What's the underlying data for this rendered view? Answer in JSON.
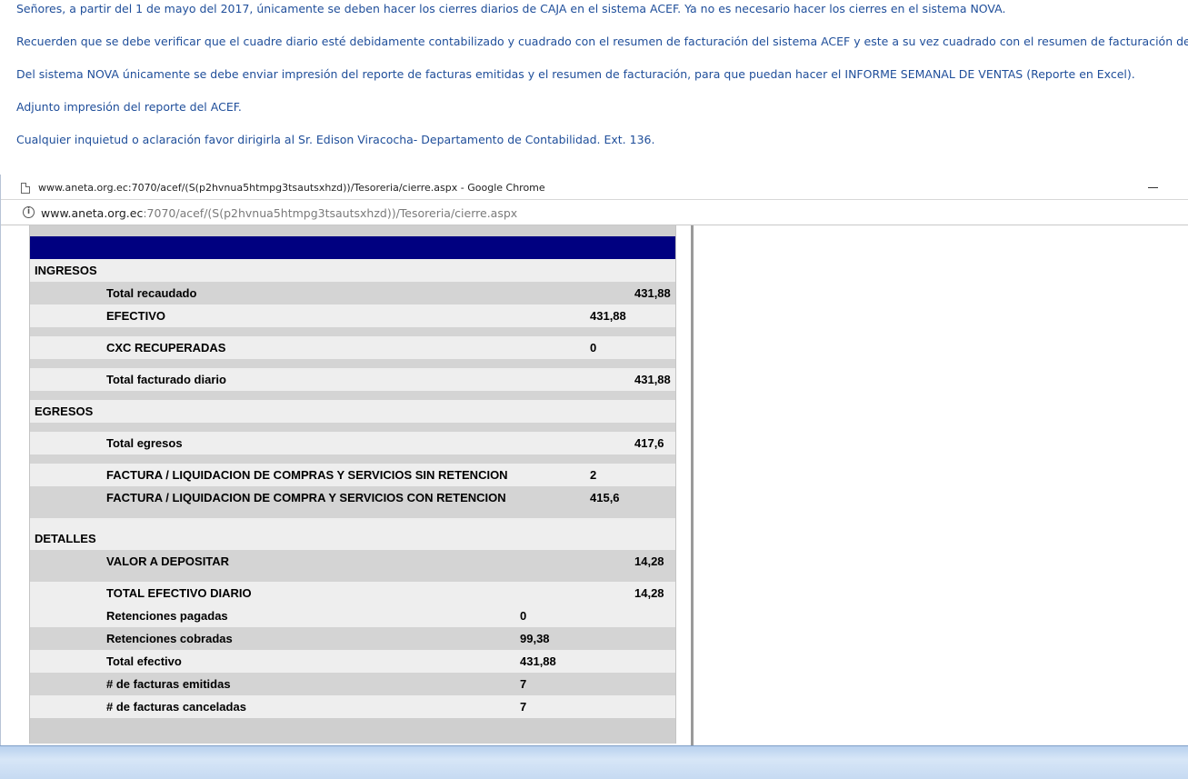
{
  "email": {
    "paragraphs": [
      "Señores, a partir del 1 de mayo del 2017, únicamente se deben hacer los cierres diarios de CAJA en el sistema ACEF. Ya no es necesario hacer los cierres en el sistema NOVA.",
      "Recuerden que se debe verificar que el cuadre diario esté debidamente contabilizado y cuadrado con el resumen de facturación del sistema ACEF y este a su vez cuadrado con el resumen de facturación del NOVA.",
      "Del sistema NOVA únicamente se debe enviar impresión del reporte de facturas emitidas y el resumen de facturación, para que puedan hacer el INFORME SEMANAL DE VENTAS (Reporte en Excel).",
      "Adjunto impresión del reporte del ACEF.",
      "Cualquier inquietud o aclaración favor dirigirla al Sr. Edison Viracocha- Departamento de Contabilidad. Ext. 136."
    ]
  },
  "browser": {
    "window_title": "www.aneta.org.ec:7070/acef/(S(p2hvnua5htmpg3tsautsxhzd))/Tesoreria/cierre.aspx - Google Chrome",
    "url_host": "www.aneta.org.ec",
    "url_rest": ":7070/acef/(S(p2hvnua5htmpg3tsautsxhzd))/Tesoreria/cierre.aspx",
    "info_icon": "info-icon",
    "page_icon": "page-icon"
  },
  "report": {
    "ingresos": {
      "heading": "INGRESOS",
      "total_recaudado_label": "Total recaudado",
      "total_recaudado_value": "431,88",
      "efectivo_label": "EFECTIVO",
      "efectivo_value": "431,88",
      "cxc_label": "CXC RECUPERADAS",
      "cxc_value": "0",
      "total_facturado_label": "Total facturado diario",
      "total_facturado_value": "431,88"
    },
    "egresos": {
      "heading": "EGRESOS",
      "total_egresos_label": "Total egresos",
      "total_egresos_value": "417,6",
      "sin_retencion_label": "FACTURA / LIQUIDACION DE COMPRAS Y SERVICIOS SIN RETENCION",
      "sin_retencion_value": "2",
      "con_retencion_label": "FACTURA / LIQUIDACION DE COMPRA Y SERVICIOS CON RETENCION",
      "con_retencion_value": "415,6"
    },
    "detalles": {
      "heading": "DETALLES",
      "valor_depositar_label": "VALOR A DEPOSITAR",
      "valor_depositar_value": "14,28",
      "total_efectivo_diario_label": "TOTAL EFECTIVO DIARIO",
      "total_efectivo_diario_value": "14,28",
      "ret_pagadas_label": "Retenciones pagadas",
      "ret_pagadas_value": "0",
      "ret_cobradas_label": "Retenciones cobradas",
      "ret_cobradas_value": "99,38",
      "total_efectivo_label": "Total efectivo",
      "total_efectivo_value": "431,88",
      "facturas_emitidas_label": "# de facturas emitidas",
      "facturas_emitidas_value": "7",
      "facturas_canceladas_label": "# de facturas canceladas",
      "facturas_canceladas_value": "7"
    },
    "colors": {
      "header_bar": "#000080",
      "row_gray": "#d4d4d4",
      "row_light": "#eeeeee"
    }
  }
}
